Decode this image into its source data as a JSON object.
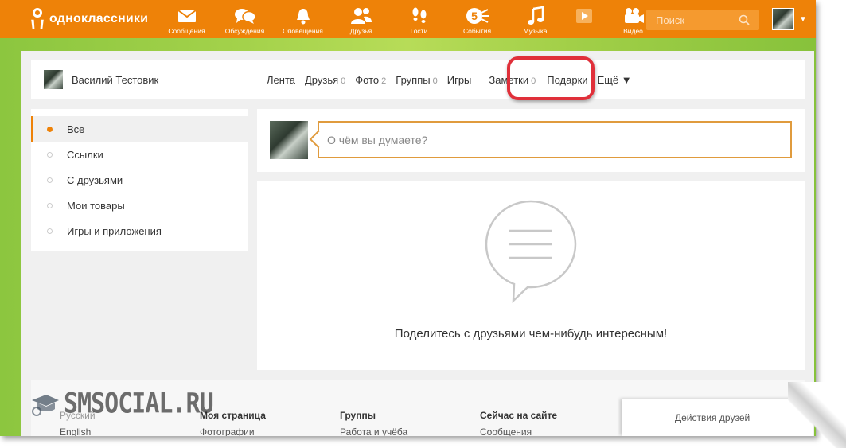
{
  "app": {
    "logo_text": "одноклассники"
  },
  "topnav": {
    "items": [
      {
        "label": "Сообщения",
        "icon": "envelope-icon"
      },
      {
        "label": "Обсуждения",
        "icon": "chat-bubbles-icon"
      },
      {
        "label": "Оповещения",
        "icon": "bell-icon"
      },
      {
        "label": "Друзья",
        "icon": "friends-icon"
      },
      {
        "label": "Гости",
        "icon": "footprints-icon"
      },
      {
        "label": "События",
        "icon": "events-icon"
      },
      {
        "label": "Музыка",
        "icon": "music-note-icon"
      },
      {
        "label": "",
        "icon": "video-play-icon"
      },
      {
        "label": "Видео",
        "icon": "camera-icon"
      }
    ],
    "events_badge": "5",
    "search_placeholder": "Поиск"
  },
  "profile": {
    "name": "Василий Тестовик",
    "tabs": [
      {
        "label": "Лента",
        "count": ""
      },
      {
        "label": "Друзья",
        "count": "0"
      },
      {
        "label": "Фото",
        "count": "2"
      },
      {
        "label": "Группы",
        "count": "0"
      },
      {
        "label": "Игры",
        "count": ""
      },
      {
        "label": "Заметки",
        "count": "0"
      },
      {
        "label": "Подарки",
        "count": ""
      },
      {
        "label": "Ещё ▼",
        "count": ""
      }
    ]
  },
  "filters": {
    "items": [
      "Все",
      "Ссылки",
      "С друзьями",
      "Мои товары",
      "Игры и приложения"
    ],
    "active_index": 0
  },
  "post": {
    "placeholder": "О чём вы думаете?"
  },
  "feed": {
    "empty_text": "Поделитесь с друзьями чем-нибудь интересным!"
  },
  "footer": {
    "columns": [
      {
        "heading": "Русский",
        "link": "English"
      },
      {
        "heading": "Моя страница",
        "link": "Фотографии"
      },
      {
        "heading": "Группы",
        "link": "Работа и учёба"
      },
      {
        "heading": "Сейчас на сайте",
        "link": "Сообщения"
      }
    ]
  },
  "watermark": {
    "text": "SMSOCIAL.RU"
  },
  "activity_panel": {
    "label": "Действия друзей"
  },
  "colors": {
    "brand_orange": "#ee8208",
    "highlight_red": "#e0303a",
    "input_border": "#e09b3d",
    "background_green": "#a4d24b"
  }
}
